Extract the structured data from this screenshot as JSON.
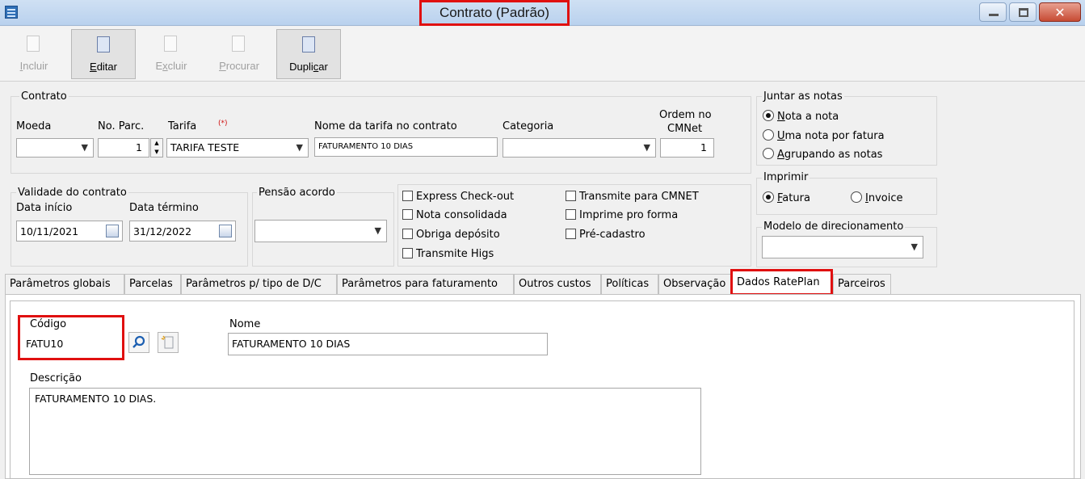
{
  "window": {
    "title": "Contrato (Padrão)"
  },
  "toolbar": {
    "buttons": [
      {
        "label": "Incluir",
        "key": "I",
        "rest": "ncluir",
        "enabled": false,
        "icon": "new-document-icon"
      },
      {
        "label": "Editar",
        "key": "E",
        "rest": "ditar",
        "enabled": true,
        "icon": "edit-document-icon"
      },
      {
        "label": "Excluir",
        "key": "x",
        "pre": "E",
        "rest": "cluir",
        "enabled": false,
        "icon": "delete-document-icon"
      },
      {
        "label": "Procurar",
        "key": "P",
        "rest": "rocurar",
        "enabled": false,
        "icon": "search-document-icon"
      },
      {
        "label": "Duplicar",
        "key": "c",
        "pre": "Dupli",
        "rest": "ar",
        "enabled": true,
        "icon": "duplicate-icon"
      }
    ]
  },
  "contrato": {
    "group_title": "Contrato",
    "moeda_label": "Moeda",
    "moeda_value": "",
    "parc_label": "No. Parc.",
    "parc_value": "1",
    "tarifa_label": "Tarifa",
    "tarifa_req": "(*)",
    "tarifa_value": "TARIFA TESTE",
    "nome_tarifa_label": "Nome da tarifa no contrato",
    "nome_tarifa_value": "FATURAMENTO 10 DIAS",
    "categoria_label": "Categoria",
    "categoria_value": "",
    "ordem_label_1": "Ordem no",
    "ordem_label_2": "CMNet",
    "ordem_value": "1"
  },
  "juntar": {
    "title": "Juntar as notas",
    "options": [
      {
        "pre": "",
        "key": "N",
        "rest": "ota a nota",
        "selected": true
      },
      {
        "pre": "",
        "key": "U",
        "rest": "ma nota por fatura",
        "selected": false
      },
      {
        "pre": "",
        "key": "A",
        "rest": "grupando as notas",
        "selected": false
      }
    ]
  },
  "validade": {
    "title": "Validade do contrato",
    "inicio_label": "Data início",
    "inicio_value": "10/11/2021",
    "termino_label": "Data término",
    "termino_value": "31/12/2022"
  },
  "pensao": {
    "title": "Pensão acordo",
    "value": ""
  },
  "checks": {
    "left": [
      {
        "label": "Express Check-out",
        "checked": false
      },
      {
        "label": "Nota consolidada",
        "checked": false
      },
      {
        "label": "Obriga depósito",
        "checked": false
      },
      {
        "label": "Transmite Higs",
        "checked": false
      }
    ],
    "right": [
      {
        "label": "Transmite para CMNET",
        "checked": false
      },
      {
        "label": "Imprime pro forma",
        "checked": false
      },
      {
        "label": "Pré-cadastro",
        "checked": false
      }
    ]
  },
  "imprimir": {
    "title": "Imprimir",
    "fatura_key": "F",
    "fatura_rest": "atura",
    "fatura_selected": true,
    "invoice_key": "I",
    "invoice_rest": "nvoice",
    "invoice_selected": false
  },
  "modelo": {
    "title": "Modelo de direcionamento",
    "value": ""
  },
  "tabs": [
    "Parâmetros globais",
    "Parcelas",
    "Parâmetros p/ tipo de D/C",
    "Parâmetros para faturamento",
    "Outros custos",
    "Políticas",
    "Observação",
    "Dados RatePlan",
    "Parceiros"
  ],
  "rateplan": {
    "codigo_label": "Código",
    "codigo_value": "FATU10",
    "nome_label": "Nome",
    "nome_value": "FATURAMENTO 10 DIAS",
    "descricao_label": "Descrição",
    "descricao_value": "FATURAMENTO 10 DIAS."
  },
  "colors": {
    "highlight": "#e01010",
    "titlebar": "#c3d8f0"
  }
}
